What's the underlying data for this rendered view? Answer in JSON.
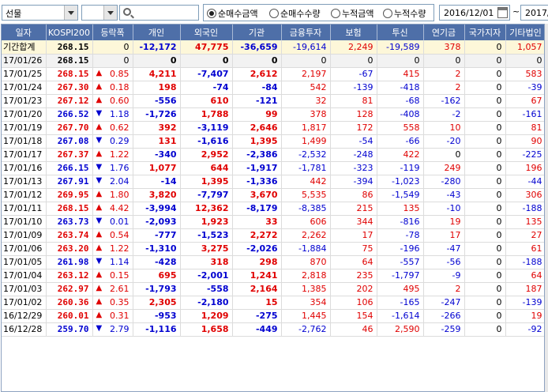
{
  "toolbar": {
    "market_select": "선물",
    "sub_select": "",
    "search_placeholder": "",
    "radios": [
      {
        "label": "순매수금액",
        "selected": true
      },
      {
        "label": "순매수수량",
        "selected": false
      },
      {
        "label": "누적금액",
        "selected": false
      },
      {
        "label": "누적수량",
        "selected": false
      }
    ],
    "date_from": "2016/12/01",
    "tilde": "~",
    "date_to": "2017/"
  },
  "columns": [
    "일자",
    "KOSPI200",
    "등락폭",
    "개인",
    "외국인",
    "기관",
    "금융투자",
    "보험",
    "투신",
    "연기금",
    "국가지자",
    "기타법인"
  ],
  "colors": {
    "up": "#e00000",
    "down": "#0000d0",
    "header_bg": "#4e6fa8",
    "total_bg": "#fdf7d9"
  },
  "rows": [
    {
      "date": "기간합계",
      "kospi": "268.15",
      "dir": "",
      "chg": "0",
      "indiv": "-12,172",
      "foreign": "47,775",
      "inst": "-36,659",
      "fin": "-19,614",
      "ins": "2,249",
      "trust": "-19,589",
      "pension": "378",
      "gov": "0",
      "etc": "1,057",
      "type": "total"
    },
    {
      "date": "17/01/26",
      "kospi": "268.15",
      "dir": "",
      "chg": "0",
      "indiv": "0",
      "foreign": "0",
      "inst": "0",
      "fin": "0",
      "ins": "0",
      "trust": "0",
      "pension": "0",
      "gov": "0",
      "etc": "0",
      "type": "plain"
    },
    {
      "date": "17/01/25",
      "kospi": "268.15",
      "dir": "up",
      "chg": "0.85",
      "indiv": "4,211",
      "foreign": "-7,407",
      "inst": "2,612",
      "fin": "2,197",
      "ins": "-67",
      "trust": "415",
      "pension": "2",
      "gov": "0",
      "etc": "583"
    },
    {
      "date": "17/01/24",
      "kospi": "267.30",
      "dir": "up",
      "chg": "0.18",
      "indiv": "198",
      "foreign": "-74",
      "inst": "-84",
      "fin": "542",
      "ins": "-139",
      "trust": "-418",
      "pension": "2",
      "gov": "0",
      "etc": "-39"
    },
    {
      "date": "17/01/23",
      "kospi": "267.12",
      "dir": "up",
      "chg": "0.60",
      "indiv": "-556",
      "foreign": "610",
      "inst": "-121",
      "fin": "32",
      "ins": "81",
      "trust": "-68",
      "pension": "-162",
      "gov": "0",
      "etc": "67"
    },
    {
      "date": "17/01/20",
      "kospi": "266.52",
      "dir": "dn",
      "chg": "1.18",
      "indiv": "-1,726",
      "foreign": "1,788",
      "inst": "99",
      "fin": "378",
      "ins": "128",
      "trust": "-408",
      "pension": "-2",
      "gov": "0",
      "etc": "-161"
    },
    {
      "date": "17/01/19",
      "kospi": "267.70",
      "dir": "up",
      "chg": "0.62",
      "indiv": "392",
      "foreign": "-3,119",
      "inst": "2,646",
      "fin": "1,817",
      "ins": "172",
      "trust": "558",
      "pension": "10",
      "gov": "0",
      "etc": "81"
    },
    {
      "date": "17/01/18",
      "kospi": "267.08",
      "dir": "dn",
      "chg": "0.29",
      "indiv": "131",
      "foreign": "-1,616",
      "inst": "1,395",
      "fin": "1,499",
      "ins": "-54",
      "trust": "-66",
      "pension": "-20",
      "gov": "0",
      "etc": "90"
    },
    {
      "date": "17/01/17",
      "kospi": "267.37",
      "dir": "up",
      "chg": "1.22",
      "indiv": "-340",
      "foreign": "2,952",
      "inst": "-2,386",
      "fin": "-2,532",
      "ins": "-248",
      "trust": "422",
      "pension": "0",
      "gov": "0",
      "etc": "-225"
    },
    {
      "date": "17/01/16",
      "kospi": "266.15",
      "dir": "dn",
      "chg": "1.76",
      "indiv": "1,077",
      "foreign": "644",
      "inst": "-1,917",
      "fin": "-1,781",
      "ins": "-323",
      "trust": "-119",
      "pension": "249",
      "gov": "0",
      "etc": "196"
    },
    {
      "date": "17/01/13",
      "kospi": "267.91",
      "dir": "dn",
      "chg": "2.04",
      "indiv": "-14",
      "foreign": "1,395",
      "inst": "-1,336",
      "fin": "442",
      "ins": "-394",
      "trust": "-1,023",
      "pension": "-280",
      "gov": "0",
      "etc": "-44"
    },
    {
      "date": "17/01/12",
      "kospi": "269.95",
      "dir": "up",
      "chg": "1.80",
      "indiv": "3,820",
      "foreign": "-7,797",
      "inst": "3,670",
      "fin": "5,535",
      "ins": "86",
      "trust": "-1,549",
      "pension": "-43",
      "gov": "0",
      "etc": "306"
    },
    {
      "date": "17/01/11",
      "kospi": "268.15",
      "dir": "up",
      "chg": "4.42",
      "indiv": "-3,994",
      "foreign": "12,362",
      "inst": "-8,179",
      "fin": "-8,385",
      "ins": "215",
      "trust": "135",
      "pension": "-10",
      "gov": "0",
      "etc": "-188"
    },
    {
      "date": "17/01/10",
      "kospi": "263.73",
      "dir": "dn",
      "chg": "0.01",
      "indiv": "-2,093",
      "foreign": "1,923",
      "inst": "33",
      "fin": "606",
      "ins": "344",
      "trust": "-816",
      "pension": "19",
      "gov": "0",
      "etc": "135"
    },
    {
      "date": "17/01/09",
      "kospi": "263.74",
      "dir": "up",
      "chg": "0.54",
      "indiv": "-777",
      "foreign": "-1,523",
      "inst": "2,272",
      "fin": "2,262",
      "ins": "17",
      "trust": "-78",
      "pension": "17",
      "gov": "0",
      "etc": "27"
    },
    {
      "date": "17/01/06",
      "kospi": "263.20",
      "dir": "up",
      "chg": "1.22",
      "indiv": "-1,310",
      "foreign": "3,275",
      "inst": "-2,026",
      "fin": "-1,884",
      "ins": "75",
      "trust": "-196",
      "pension": "-47",
      "gov": "0",
      "etc": "61"
    },
    {
      "date": "17/01/05",
      "kospi": "261.98",
      "dir": "dn",
      "chg": "1.14",
      "indiv": "-428",
      "foreign": "318",
      "inst": "298",
      "fin": "870",
      "ins": "64",
      "trust": "-557",
      "pension": "-56",
      "gov": "0",
      "etc": "-188"
    },
    {
      "date": "17/01/04",
      "kospi": "263.12",
      "dir": "up",
      "chg": "0.15",
      "indiv": "695",
      "foreign": "-2,001",
      "inst": "1,241",
      "fin": "2,818",
      "ins": "235",
      "trust": "-1,797",
      "pension": "-9",
      "gov": "0",
      "etc": "64"
    },
    {
      "date": "17/01/03",
      "kospi": "262.97",
      "dir": "up",
      "chg": "2.61",
      "indiv": "-1,793",
      "foreign": "-558",
      "inst": "2,164",
      "fin": "1,385",
      "ins": "202",
      "trust": "495",
      "pension": "2",
      "gov": "0",
      "etc": "187"
    },
    {
      "date": "17/01/02",
      "kospi": "260.36",
      "dir": "up",
      "chg": "0.35",
      "indiv": "2,305",
      "foreign": "-2,180",
      "inst": "15",
      "fin": "354",
      "ins": "106",
      "trust": "-165",
      "pension": "-247",
      "gov": "0",
      "etc": "-139"
    },
    {
      "date": "16/12/29",
      "kospi": "260.01",
      "dir": "up",
      "chg": "0.31",
      "indiv": "-953",
      "foreign": "1,209",
      "inst": "-275",
      "fin": "1,445",
      "ins": "154",
      "trust": "-1,614",
      "pension": "-266",
      "gov": "0",
      "etc": "19"
    },
    {
      "date": "16/12/28",
      "kospi": "259.70",
      "dir": "dn",
      "chg": "2.79",
      "indiv": "-1,116",
      "foreign": "1,658",
      "inst": "-449",
      "fin": "-2,762",
      "ins": "46",
      "trust": "2,590",
      "pension": "-259",
      "gov": "0",
      "etc": "-92"
    }
  ]
}
